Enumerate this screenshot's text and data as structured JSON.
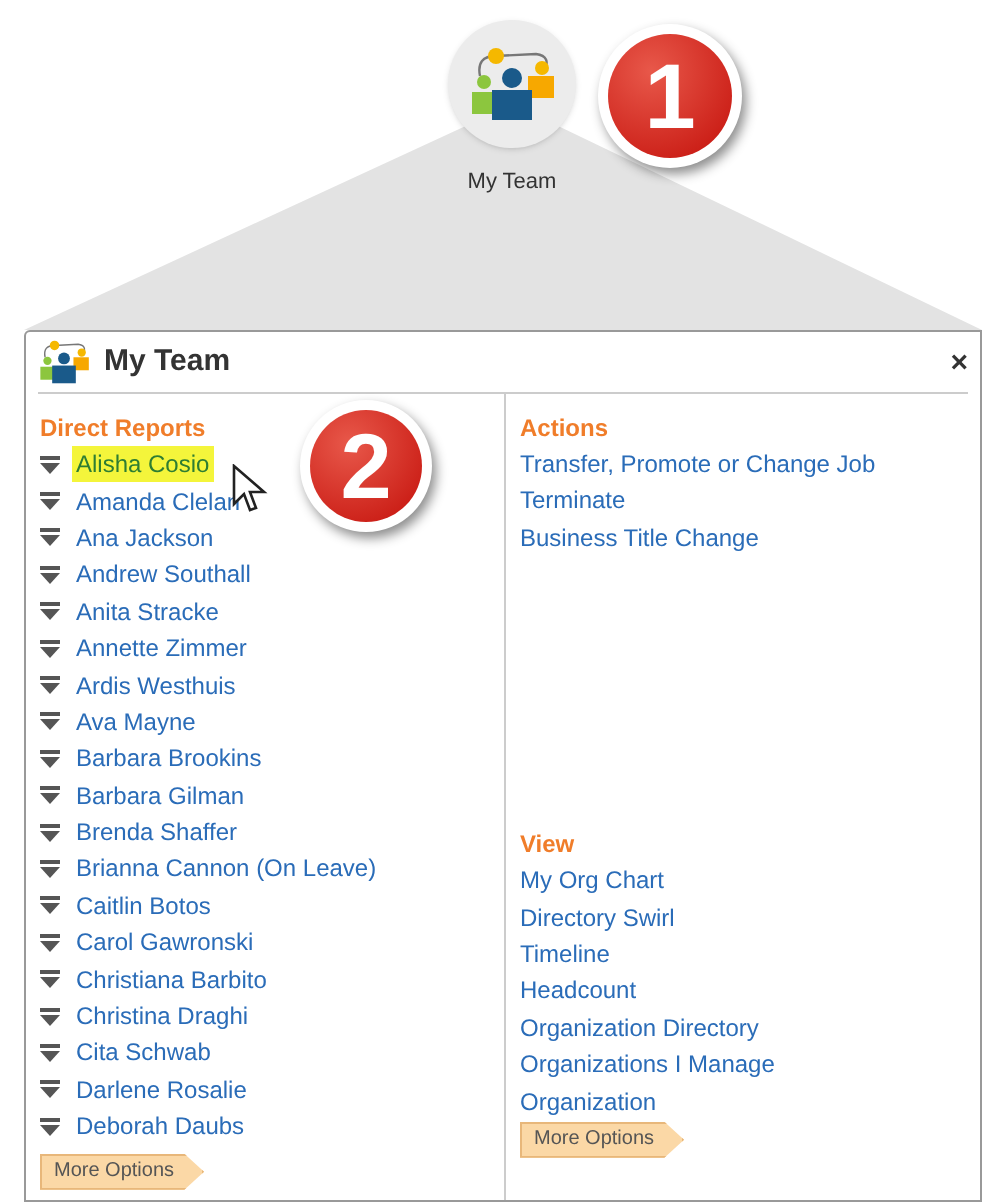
{
  "launcher": {
    "label": "My Team"
  },
  "callouts": [
    "1",
    "2"
  ],
  "panel": {
    "title": "My Team",
    "close": "×"
  },
  "direct_reports": {
    "heading": "Direct Reports",
    "items": [
      {
        "name": "Alisha Cosio",
        "selected": true
      },
      {
        "name": "Amanda Clelan",
        "selected": false
      },
      {
        "name": "Ana Jackson",
        "selected": false
      },
      {
        "name": "Andrew Southall",
        "selected": false
      },
      {
        "name": "Anita Stracke",
        "selected": false
      },
      {
        "name": "Annette Zimmer",
        "selected": false
      },
      {
        "name": "Ardis Westhuis",
        "selected": false
      },
      {
        "name": "Ava Mayne",
        "selected": false
      },
      {
        "name": "Barbara Brookins",
        "selected": false
      },
      {
        "name": "Barbara Gilman",
        "selected": false
      },
      {
        "name": "Brenda Shaffer",
        "selected": false
      },
      {
        "name": "Brianna Cannon (On Leave)",
        "selected": false
      },
      {
        "name": "Caitlin Botos",
        "selected": false
      },
      {
        "name": "Carol Gawronski",
        "selected": false
      },
      {
        "name": "Christiana Barbito",
        "selected": false
      },
      {
        "name": "Christina Draghi",
        "selected": false
      },
      {
        "name": "Cita Schwab",
        "selected": false
      },
      {
        "name": "Darlene Rosalie",
        "selected": false
      },
      {
        "name": "Deborah Daubs",
        "selected": false
      }
    ],
    "more": "More Options"
  },
  "actions": {
    "heading": "Actions",
    "items": [
      "Transfer, Promote or Change Job",
      "Terminate",
      "Business Title Change"
    ]
  },
  "view": {
    "heading": "View",
    "items": [
      "My Org Chart",
      "Directory Swirl",
      "Timeline",
      "Headcount",
      "Organization Directory",
      "Organizations I Manage",
      "Organization"
    ],
    "more": "More Options"
  }
}
